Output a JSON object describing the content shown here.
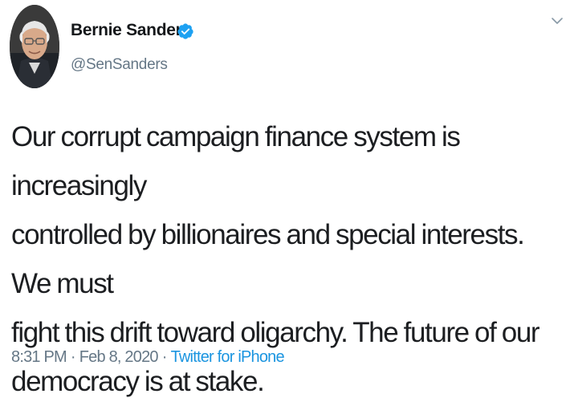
{
  "tweet": {
    "display_name": "Bernie Sanders",
    "handle": "@SenSanders",
    "verified": true,
    "avatar_icon": "profile-photo",
    "text": "Our corrupt campaign finance system is increasingly\ncontrolled by billionaires and special interests. We must\nfight this drift toward oligarchy. The future of our\ndemocracy is at stake.",
    "time": "8:31 PM",
    "date": "Feb 8, 2020",
    "separator": "·",
    "source": "Twitter for iPhone"
  },
  "icons": {
    "verified": "verified-badge-icon",
    "menu": "chevron-down-icon"
  },
  "colors": {
    "verified_badge": "#1da1f2",
    "link": "#1b95e0",
    "muted_text": "#657786",
    "body_text": "#1c1e21"
  }
}
